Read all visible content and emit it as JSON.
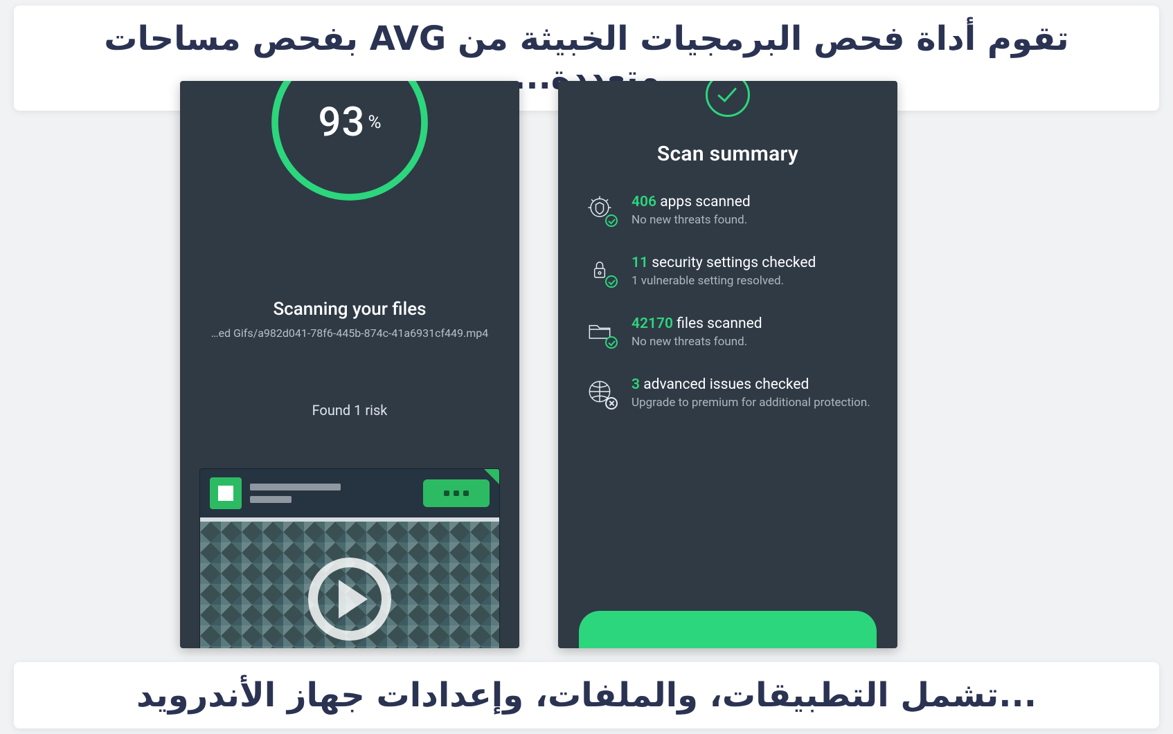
{
  "caption_top": "تقوم أداة فحص البرمجيات الخبيثة من AVG بفحص مساحات متعددة...",
  "caption_bottom": "...تشمل التطبيقات، والملفات، وإعدادات جهاز الأندرويد",
  "left_phone": {
    "progress_value": "93",
    "progress_pct_symbol": "%",
    "title": "Scanning your files",
    "file_path": "…ed Gifs/a982d041-78f6-445b-874c-41a6931cf449.mp4",
    "risk_status": "Found 1 risk"
  },
  "right_phone": {
    "title": "Scan summary",
    "items": [
      {
        "count": "406",
        "label": " apps scanned",
        "sub": "No new threats found."
      },
      {
        "count": "11",
        "label": " security settings checked",
        "sub": "1 vulnerable setting resolved."
      },
      {
        "count": "42170",
        "label": " files scanned",
        "sub": "No new threats found."
      },
      {
        "count": "3",
        "label": " advanced issues checked",
        "sub": "Upgrade to premium for additional protection."
      }
    ]
  }
}
